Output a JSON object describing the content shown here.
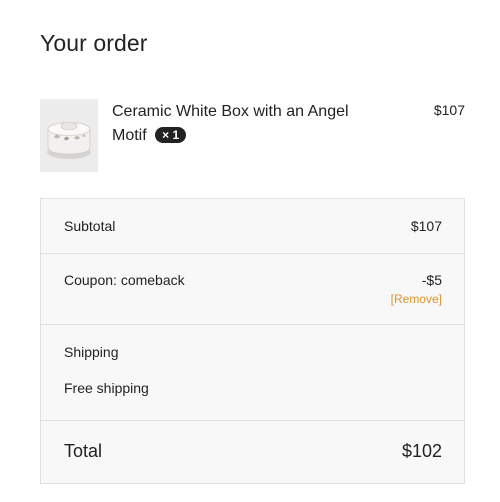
{
  "order": {
    "heading": "Your order",
    "item": {
      "name": "Ceramic White Box with an Angel Motif",
      "quantity": "× 1",
      "price": "$107",
      "image_icon": "ceramic-box-image"
    }
  },
  "summary": {
    "subtotal_label": "Subtotal",
    "subtotal_value": "$107",
    "coupon_label": "Coupon: comeback",
    "coupon_value": "-$5",
    "remove_label": "[Remove]",
    "shipping_label": "Shipping",
    "shipping_method": "Free shipping",
    "total_label": "Total",
    "total_value": "$102"
  },
  "colors": {
    "accent_link": "#e0932a",
    "qty_badge_bg": "#222222",
    "panel_bg": "#f8f8f8",
    "panel_border": "#e1e1e1"
  }
}
